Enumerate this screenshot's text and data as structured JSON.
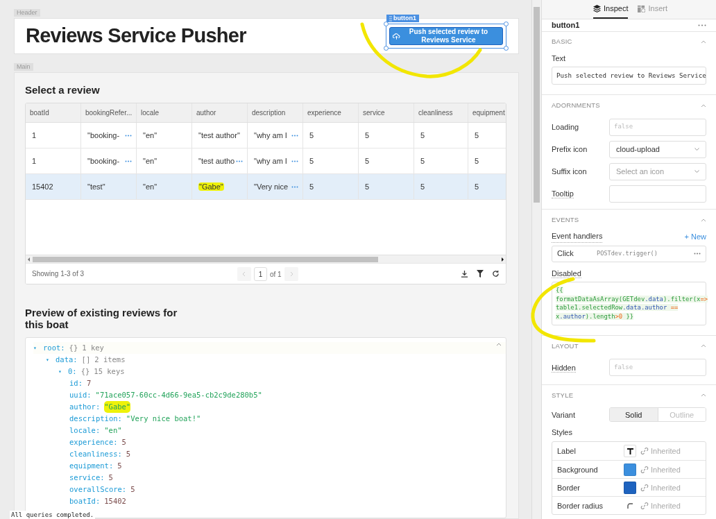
{
  "canvas": {
    "header_label": "Header",
    "title": "Reviews Service Pusher",
    "button": {
      "tag": "button1",
      "label": "Push selected review to Reviews Service",
      "selected": true
    },
    "main_label": "Main"
  },
  "table": {
    "heading": "Select a review",
    "columns": [
      "boatId",
      "bookingRefer...",
      "locale",
      "author",
      "description",
      "experience",
      "service",
      "cleanliness",
      "equipment"
    ],
    "rows": [
      {
        "selected": false,
        "cells": [
          {
            "text": "1",
            "more": false,
            "highlighted": false
          },
          {
            "text": "\"booking-",
            "more": true,
            "highlighted": false
          },
          {
            "text": "\"en\"",
            "more": false,
            "highlighted": false
          },
          {
            "text": "\"test author\"",
            "more": false,
            "highlighted": false
          },
          {
            "text": "\"why am I",
            "more": true,
            "highlighted": false
          },
          {
            "text": "5",
            "more": false,
            "highlighted": false
          },
          {
            "text": "5",
            "more": false,
            "highlighted": false
          },
          {
            "text": "5",
            "more": false,
            "highlighted": false
          },
          {
            "text": "5",
            "more": false,
            "highlighted": false
          }
        ]
      },
      {
        "selected": false,
        "cells": [
          {
            "text": "1",
            "more": false,
            "highlighted": false
          },
          {
            "text": "\"booking-",
            "more": true,
            "highlighted": false
          },
          {
            "text": "\"en\"",
            "more": false,
            "highlighted": false
          },
          {
            "text": "\"test autho",
            "more": true,
            "highlighted": false
          },
          {
            "text": "\"why am I",
            "more": true,
            "highlighted": false
          },
          {
            "text": "5",
            "more": false,
            "highlighted": false
          },
          {
            "text": "5",
            "more": false,
            "highlighted": false
          },
          {
            "text": "5",
            "more": false,
            "highlighted": false
          },
          {
            "text": "5",
            "more": false,
            "highlighted": false
          }
        ]
      },
      {
        "selected": true,
        "cells": [
          {
            "text": "15402",
            "more": false,
            "highlighted": false
          },
          {
            "text": "\"test\"",
            "more": false,
            "highlighted": false
          },
          {
            "text": "\"en\"",
            "more": false,
            "highlighted": false
          },
          {
            "text": "\"Gabe\"",
            "more": false,
            "highlighted": true
          },
          {
            "text": "\"Very nice",
            "more": true,
            "highlighted": false
          },
          {
            "text": "5",
            "more": false,
            "highlighted": false
          },
          {
            "text": "5",
            "more": false,
            "highlighted": false
          },
          {
            "text": "5",
            "more": false,
            "highlighted": false
          },
          {
            "text": "5",
            "more": false,
            "highlighted": false
          }
        ]
      }
    ],
    "footer": {
      "showing": "Showing 1-3 of 3",
      "page": "1",
      "of_pages": "of 1"
    }
  },
  "preview": {
    "heading": "Preview of existing reviews for this boat",
    "tree": {
      "toggle": "▾",
      "key": "root:",
      "type": "{}",
      "summary": "1 key",
      "expanded": true,
      "children": [
        {
          "toggle": "▾",
          "key": "data:",
          "type": "[]",
          "summary": "2 items",
          "expanded": true,
          "children": [
            {
              "toggle": "▾",
              "key": "0:",
              "type": "{}",
              "summary": "15 keys",
              "expanded": true,
              "children": [
                {
                  "key": "id:",
                  "value": "7",
                  "kind": "number",
                  "highlighted": false
                },
                {
                  "key": "uuid:",
                  "value": "\"71ace057-60cc-4d66-9ea5-cb2c9de280b5\"",
                  "kind": "string",
                  "highlighted": false
                },
                {
                  "key": "author:",
                  "value": "\"Gabe\"",
                  "kind": "string",
                  "highlighted": true
                },
                {
                  "key": "description:",
                  "value": "\"Very nice boat!\"",
                  "kind": "string",
                  "highlighted": false
                },
                {
                  "key": "locale:",
                  "value": "\"en\"",
                  "kind": "string",
                  "highlighted": false
                },
                {
                  "key": "experience:",
                  "value": "5",
                  "kind": "number",
                  "highlighted": false
                },
                {
                  "key": "cleanliness:",
                  "value": "5",
                  "kind": "number",
                  "highlighted": false
                },
                {
                  "key": "equipment:",
                  "value": "5",
                  "kind": "number",
                  "highlighted": false
                },
                {
                  "key": "service:",
                  "value": "5",
                  "kind": "number",
                  "highlighted": false
                },
                {
                  "key": "overallScore:",
                  "value": "5",
                  "kind": "number",
                  "highlighted": false
                },
                {
                  "key": "boatId:",
                  "value": "15402",
                  "kind": "number",
                  "highlighted": false
                }
              ]
            }
          ]
        }
      ]
    }
  },
  "status_bar": "All queries completed.",
  "inspector": {
    "tabs": [
      {
        "label": "Inspect",
        "selected": true
      },
      {
        "label": "Insert",
        "selected": false
      }
    ],
    "component": "button1",
    "basic": {
      "title": "BASIC",
      "text_label": "Text",
      "text_value": "Push selected review to Reviews Service"
    },
    "adornments": {
      "title": "ADORNMENTS",
      "loading_label": "Loading",
      "loading_placeholder": "false",
      "prefix_label": "Prefix icon",
      "prefix_value": "cloud-upload",
      "suffix_label": "Suffix icon",
      "suffix_placeholder": "Select an icon",
      "tooltip_label": "Tooltip"
    },
    "events": {
      "title": "EVENTS",
      "handlers_label": "Event handlers",
      "new_link": "+ New",
      "handler_event": "Click",
      "handler_action": "POSTdev.trigger()",
      "disabled_label": "Disabled",
      "disabled_code": [
        [
          {
            "text": "{{",
            "kind": "plain"
          }
        ],
        [
          {
            "text": "formatDataAsArray(GETdev",
            "kind": "plain"
          },
          {
            "text": ".data",
            "kind": "prop"
          },
          {
            "text": ").filter(x",
            "kind": "plain"
          },
          {
            "text": "=>",
            "kind": "op"
          }
        ],
        [
          {
            "text": "table1.selectedRow",
            "kind": "plain"
          },
          {
            "text": ".data.author",
            "kind": "prop"
          },
          {
            "text": " ==",
            "kind": "op"
          }
        ],
        [
          {
            "text": "x",
            "kind": "plain"
          },
          {
            "text": ".author",
            "kind": "prop"
          },
          {
            "text": ").length",
            "kind": "plain"
          },
          {
            "text": ">0",
            "kind": "op"
          },
          {
            "text": " }}",
            "kind": "plain"
          }
        ]
      ]
    },
    "layout": {
      "title": "LAYOUT",
      "hidden_label": "Hidden",
      "hidden_placeholder": "false"
    },
    "style": {
      "title": "STYLE",
      "variant_label": "Variant",
      "variants": [
        {
          "label": "Solid",
          "selected": true
        },
        {
          "label": "Outline",
          "selected": false
        }
      ],
      "styles_label": "Styles",
      "styles": [
        {
          "name": "Label",
          "kind": "text",
          "value": "Inherited"
        },
        {
          "name": "Background",
          "kind": "color",
          "color": "#3b8fde",
          "value": "Inherited"
        },
        {
          "name": "Border",
          "kind": "color",
          "color": "#1e63bf",
          "value": "Inherited"
        },
        {
          "name": "Border radius",
          "kind": "radius",
          "value": "Inherited"
        }
      ]
    }
  }
}
